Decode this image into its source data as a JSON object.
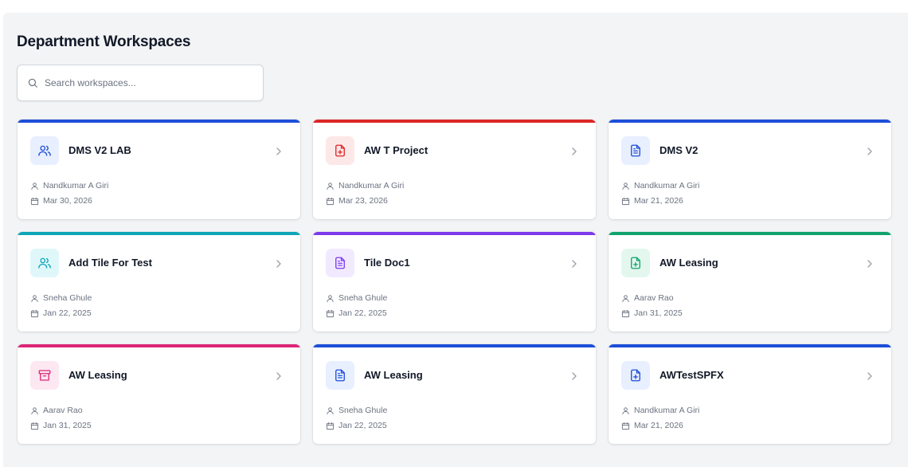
{
  "page": {
    "title": "Department Workspaces",
    "search_placeholder": "Search workspaces..."
  },
  "colors": {
    "blue": "#1d4ed8",
    "red": "#dc2626",
    "cyan": "#0ea5b7",
    "purple": "#7c3aed",
    "green": "#10a36e",
    "pink": "#db2777"
  },
  "workspaces": [
    {
      "name": "DMS V2 LAB",
      "owner": "Nandkumar A Giri",
      "date": "Mar 30, 2026",
      "color": "blue",
      "icon": "users-icon"
    },
    {
      "name": "AW T Project",
      "owner": "Nandkumar A Giri",
      "date": "Mar 23, 2026",
      "color": "red",
      "icon": "file-plus-icon"
    },
    {
      "name": "DMS V2",
      "owner": "Nandkumar A Giri",
      "date": "Mar 21, 2026",
      "color": "blue",
      "icon": "file-text-icon"
    },
    {
      "name": "Add Tile For Test",
      "owner": "Sneha Ghule",
      "date": "Jan 22, 2025",
      "color": "cyan",
      "icon": "users-icon"
    },
    {
      "name": "Tile Doc1",
      "owner": "Sneha Ghule",
      "date": "Jan 22, 2025",
      "color": "purple",
      "icon": "file-text-icon"
    },
    {
      "name": "AW Leasing",
      "owner": "Aarav Rao",
      "date": "Jan 31, 2025",
      "color": "green",
      "icon": "file-plus-icon"
    },
    {
      "name": "AW Leasing",
      "owner": "Aarav Rao",
      "date": "Jan 31, 2025",
      "color": "pink",
      "icon": "archive-icon"
    },
    {
      "name": "AW Leasing",
      "owner": "Sneha Ghule",
      "date": "Jan 22, 2025",
      "color": "blue",
      "icon": "file-text-icon"
    },
    {
      "name": "AWTestSPFX",
      "owner": "Nandkumar A Giri",
      "date": "Mar 21, 2026",
      "color": "blue",
      "icon": "file-plus-icon"
    }
  ]
}
